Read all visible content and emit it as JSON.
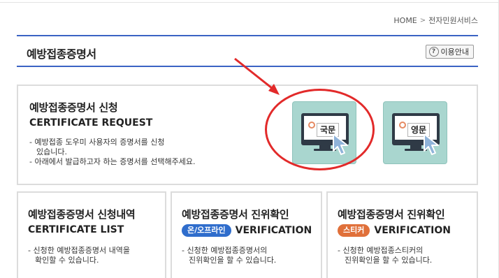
{
  "breadcrumb": {
    "home": "HOME",
    "separator": ">",
    "current": "전자민원서비스"
  },
  "header": {
    "title": "예방접종증명서",
    "guide_button": "이용안내"
  },
  "request": {
    "title_ko": "예방접종증명서 신청",
    "title_en": "CERTIFICATE REQUEST",
    "desc_line1": "- 예방접종 도우미 사용자의 증명서를 신청",
    "desc_line1b": "있습니다.",
    "desc_line2": "- 아래에서 발급하고자 하는 증명서를 선택해주세요.",
    "buttons": [
      {
        "label": "국문"
      },
      {
        "label": "영문"
      }
    ]
  },
  "cards": [
    {
      "title_ko": "예방접종증명서 신청내역",
      "title_en": "CERTIFICATE LIST",
      "badge": "",
      "desc_line1": "- 신청한 예방접종증명서 내역을",
      "desc_line2": "확인할 수 있습니다."
    },
    {
      "title_ko": "예방접종증명서 진위확인",
      "title_en": "VERIFICATION",
      "badge": "온/오프라인",
      "desc_line1": "- 신청한 예방접종증명서의",
      "desc_line2": "진위확인을 할 수 있습니다."
    },
    {
      "title_ko": "예방접종증명서 진위확인",
      "title_en": "VERIFICATION",
      "badge": "스티커",
      "desc_line1": "- 신청한 예방접종스티커의",
      "desc_line2": "진위확인을 할 수 있습니다."
    }
  ],
  "colors": {
    "accent": "#3b63c4",
    "button_bg": "#a9d6cf",
    "highlight_red": "#e22a2a",
    "badge_blue": "#2f6dcc",
    "badge_orange": "#e0703a"
  },
  "icons": {
    "help": "question-circle-icon",
    "monitor": "monitor-icon",
    "cursor": "mouse-cursor-icon",
    "medal": "medal-icon"
  }
}
